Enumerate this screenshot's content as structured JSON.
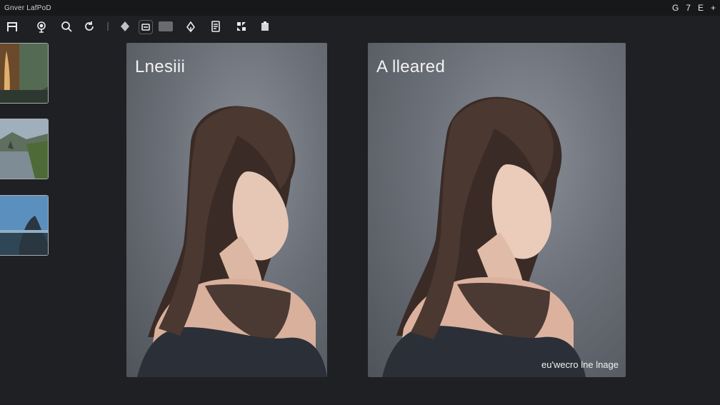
{
  "window": {
    "title": "Gnver LafPoD",
    "controls": [
      "G",
      "7",
      "E",
      "+"
    ]
  },
  "toolbar": {
    "tools": [
      {
        "name": "layout-icon"
      },
      {
        "name": "target-icon"
      },
      {
        "name": "zoom-icon"
      },
      {
        "name": "rotate-icon"
      },
      {
        "name": "separator-icon"
      },
      {
        "name": "fill-icon"
      },
      {
        "name": "image-toggle-icon"
      },
      {
        "name": "color-swatch"
      },
      {
        "name": "pen-icon"
      },
      {
        "name": "document-icon"
      },
      {
        "name": "effects-icon"
      },
      {
        "name": "export-icon"
      }
    ]
  },
  "thumbnails": [
    {
      "name": "thumbnail-waterfall",
      "colors": [
        "#3c4a3a",
        "#a8723a"
      ]
    },
    {
      "name": "thumbnail-river",
      "colors": [
        "#8a9aa6",
        "#4f6a3c"
      ]
    },
    {
      "name": "thumbnail-coast",
      "colors": [
        "#4f84b4",
        "#2c3c48"
      ]
    }
  ],
  "panels": {
    "left": {
      "label": "Lnesiii"
    },
    "right": {
      "label": "A lleared",
      "caption": "eu'wecro lne lnage"
    }
  },
  "colors": {
    "background": "#1f2023",
    "titlebar": "#17181a",
    "panel_backdrop": "#6c7078",
    "hair": "#3b2d28",
    "sweater": "#2b3038"
  }
}
